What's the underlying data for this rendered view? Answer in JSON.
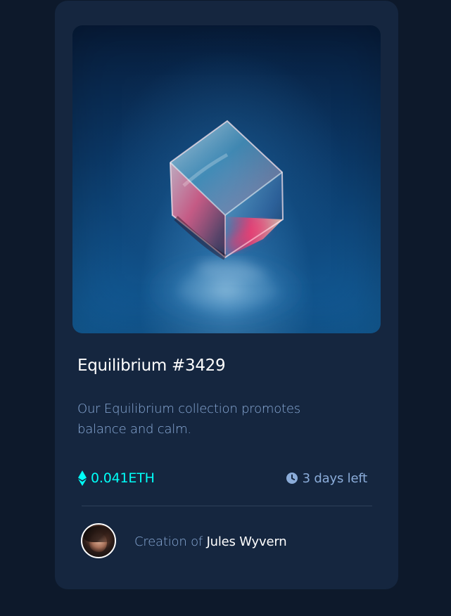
{
  "colors": {
    "page_background": "#0d192b",
    "card_background": "#15263f",
    "title": "#ffffff",
    "muted_text": "#8bacd9",
    "accent_cyan": "#00fff8",
    "divider": "#2e405a"
  },
  "card": {
    "artwork": {
      "icon": "crystal-cube-image"
    },
    "title": "Equilibrium #3429",
    "description": "Our Equilibrium collection promotes balance and calm.",
    "price": {
      "icon": "ethereum-icon",
      "label": "0.041ETH"
    },
    "time_remaining": {
      "icon": "clock-icon",
      "label": "3 days left"
    },
    "creator": {
      "avatar": "avatar-image",
      "prefix": "Creation of",
      "name": "Jules Wyvern"
    }
  }
}
